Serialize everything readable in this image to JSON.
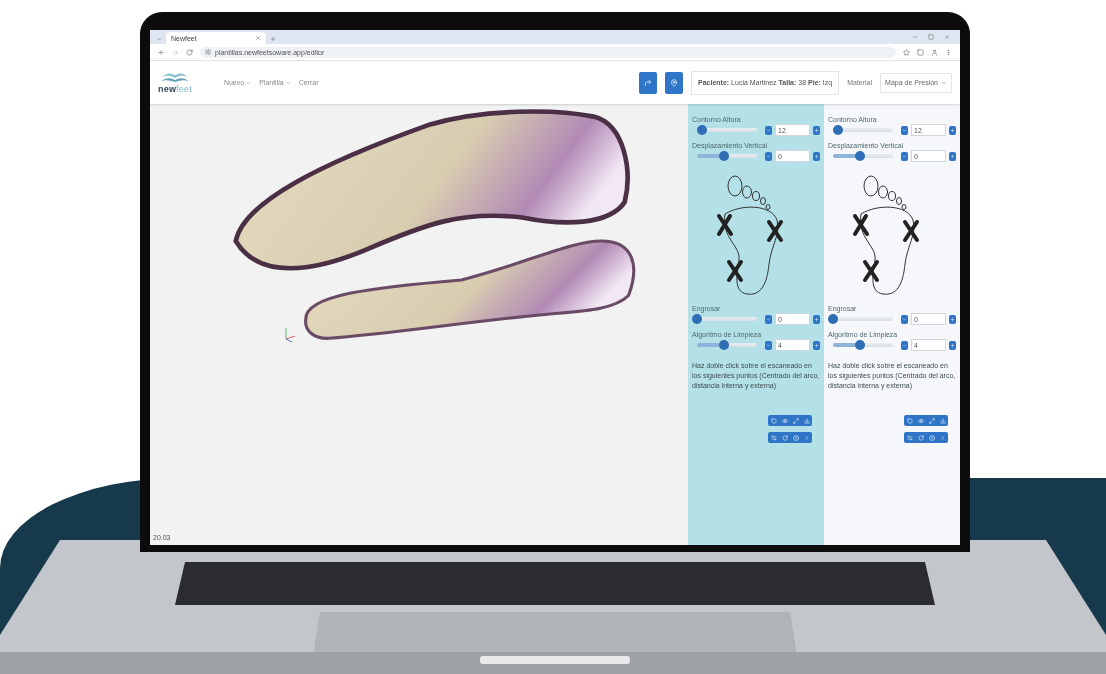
{
  "browser": {
    "tab_title": "Newfeet",
    "url": "plantillas.newfeetsoware.app/editor"
  },
  "app": {
    "logo": "**new**feet",
    "menu": [
      {
        "label": "Nuevo",
        "dropdown": true
      },
      {
        "label": "Plantilla",
        "dropdown": true
      },
      {
        "label": "Cerrar",
        "dropdown": false
      }
    ],
    "patient_info": "**Paciente:** Lucia Martinez **Talla:** 38 **Pie:** Izq",
    "material_label": "Material",
    "view_select": "Mapa de Presión"
  },
  "viewport": {
    "status": "20.03"
  },
  "panels": [
    {
      "selected": true,
      "sliders": [
        {
          "label": "Contorno Altura",
          "level": 0.08,
          "value": "12"
        },
        {
          "label": "Desplazamiento Vertical",
          "level": 0.45,
          "value": "0"
        },
        {
          "label": "Engrosar",
          "level": 0.0,
          "value": "0"
        },
        {
          "label": "Algoritmo de Limpieza",
          "level": 0.45,
          "value": "4"
        }
      ],
      "instructions": "Haz doble click sobre el escaneado en los siguientes puntos (Centrado del arco, distancia interna y externa)"
    },
    {
      "selected": false,
      "sliders": [
        {
          "label": "Contorno Altura",
          "level": 0.08,
          "value": "12"
        },
        {
          "label": "Desplazamiento Vertical",
          "level": 0.45,
          "value": "0"
        },
        {
          "label": "Engrosar",
          "level": 0.0,
          "value": "0"
        },
        {
          "label": "Algoritmo de Limpieza",
          "level": 0.45,
          "value": "4"
        }
      ],
      "instructions": "Haz doble click sobre el escaneado en los siguientes puntos (Centrado del arco, distancia interna y externa)"
    }
  ]
}
